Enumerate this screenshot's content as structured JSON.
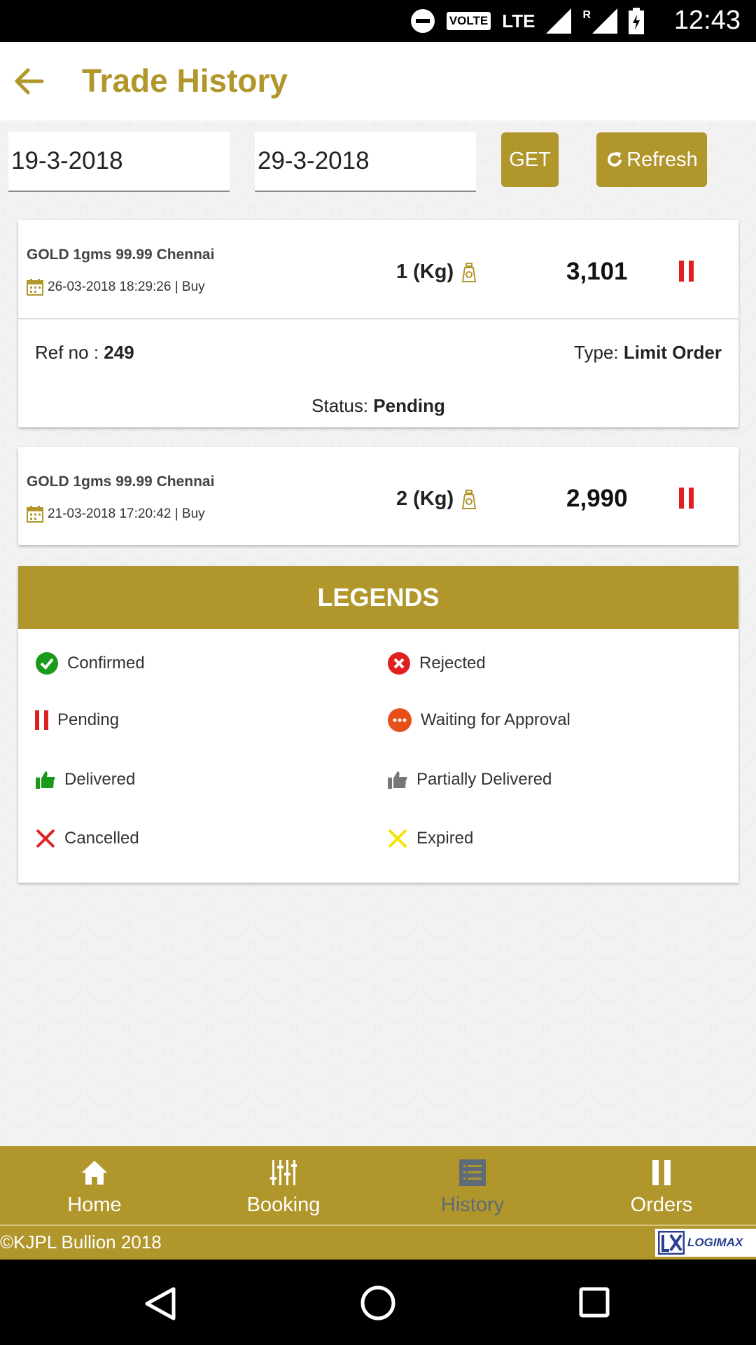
{
  "status_bar": {
    "time": "12:43",
    "volte": "VOLTE",
    "lte": "LTE",
    "roaming": "R"
  },
  "header": {
    "title": "Trade History"
  },
  "filters": {
    "from_date": "19-3-2018",
    "to_date": "29-3-2018",
    "get_label": "GET",
    "refresh_label": "Refresh"
  },
  "trades": [
    {
      "product": "GOLD 1gms 99.99 Chennai",
      "datetime": "26-03-2018 18:29:26 | Buy",
      "qty": "1 (Kg)",
      "price": "3,101",
      "ref_label": "Ref no : ",
      "ref_no": "249",
      "type_label": "Type: ",
      "type": "Limit Order",
      "status_label": "Status: ",
      "status": "Pending"
    },
    {
      "product": "GOLD 1gms 99.99 Chennai",
      "datetime": "21-03-2018 17:20:42 | Buy",
      "qty": "2 (Kg)",
      "price": "2,990"
    }
  ],
  "legends": {
    "title": "LEGENDS",
    "items": [
      "Confirmed",
      "Rejected",
      "Pending",
      "Waiting for Approval",
      "Delivered",
      "Partially Delivered",
      "Cancelled",
      "Expired"
    ]
  },
  "nav": {
    "items": [
      {
        "label": "Home"
      },
      {
        "label": "Booking"
      },
      {
        "label": "History"
      },
      {
        "label": "Orders"
      }
    ],
    "active": "History"
  },
  "footer": {
    "copyright": "©KJPL Bullion 2018",
    "brand": "LOGIMAX"
  },
  "colors": {
    "gold": "#b1962b",
    "pending_red": "#e02020",
    "confirmed_green": "#1a9a1a",
    "waiting_orange": "#e8501a",
    "expired_yellow": "#f5e400",
    "active_nav": "#5e6b78"
  }
}
